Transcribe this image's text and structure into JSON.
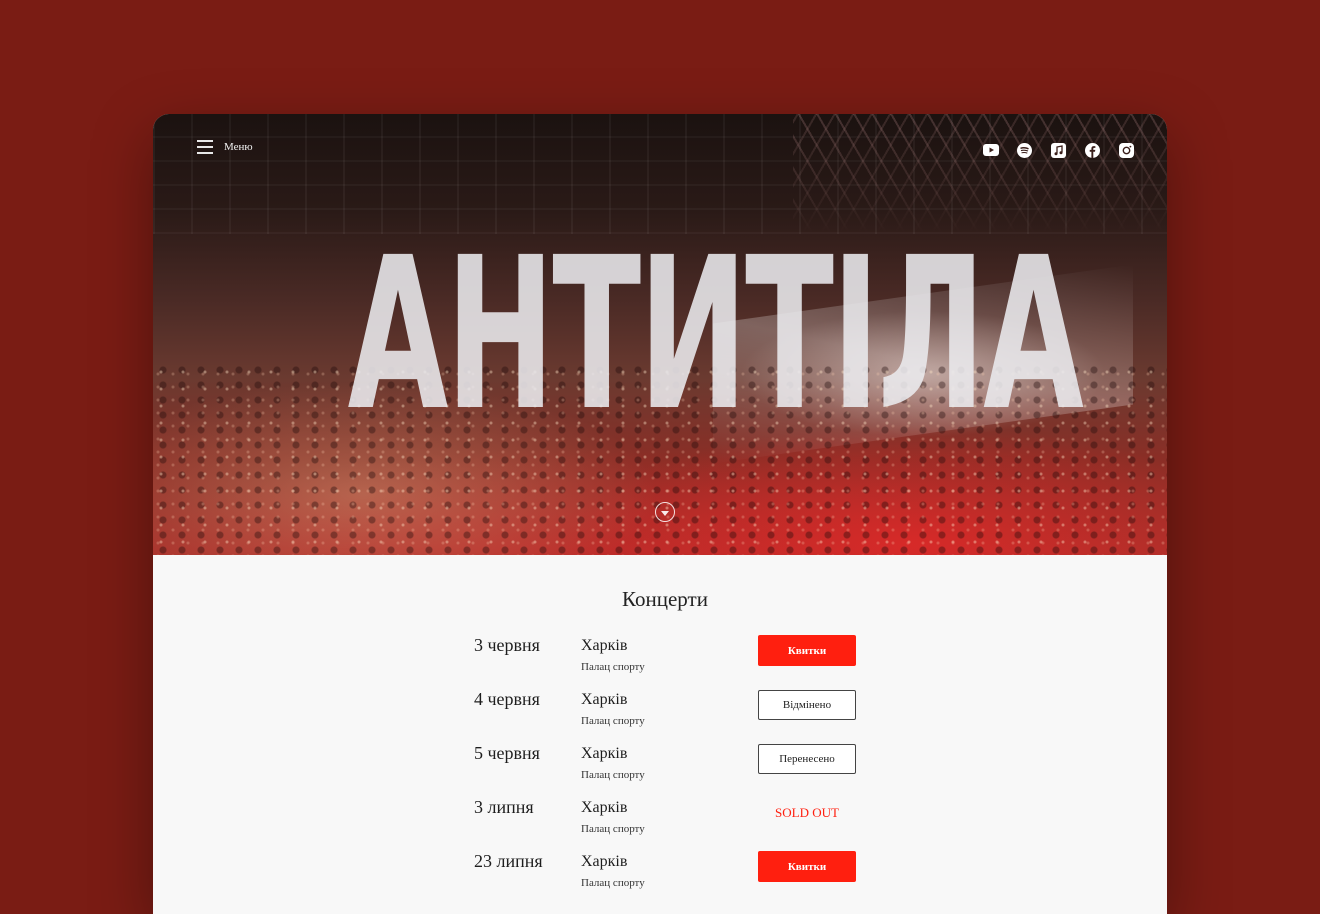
{
  "hero": {
    "band_name": "АНТИТІЛА",
    "menu_label": "Меню",
    "social_icons": [
      "youtube-icon",
      "spotify-icon",
      "apple-music-icon",
      "facebook-icon",
      "instagram-icon"
    ]
  },
  "concerts": {
    "title": "Концерти",
    "items": [
      {
        "date": "3 червня",
        "city": "Харків",
        "venue": "Палац спорту",
        "action": "Квитки",
        "status": "tickets"
      },
      {
        "date": "4 червня",
        "city": "Харків",
        "venue": "Палац спорту",
        "action": "Відмінено",
        "status": "cancelled"
      },
      {
        "date": "5 червня",
        "city": "Харків",
        "venue": "Палац спорту",
        "action": "Перенесено",
        "status": "postponed"
      },
      {
        "date": "3 липня",
        "city": "Харків",
        "venue": "Палац спорту",
        "action": "SOLD OUT",
        "status": "soldout"
      },
      {
        "date": "23 липня",
        "city": "Харків",
        "venue": "Палац спорту",
        "action": "Квитки",
        "status": "tickets"
      }
    ]
  },
  "colors": {
    "page_background": "#7a1c14",
    "accent": "#ff1f0f",
    "content_background": "#f8f8f8"
  }
}
